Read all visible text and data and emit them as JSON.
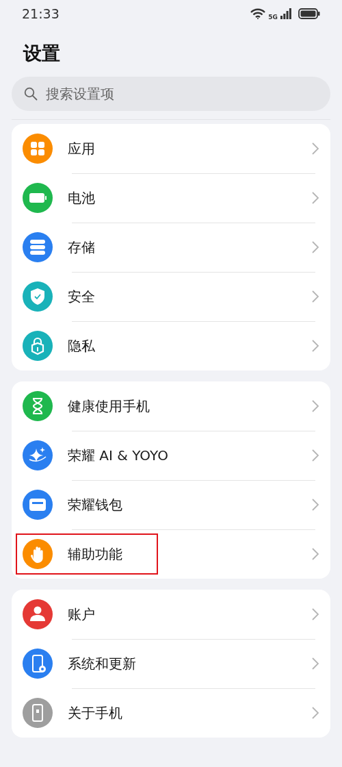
{
  "status_bar": {
    "time": "21:33",
    "network": "5G"
  },
  "title": "设置",
  "search": {
    "placeholder": "搜索设置项"
  },
  "groups": [
    {
      "items": [
        {
          "label": "应用",
          "color": "#fb8c00",
          "highlighted": false
        },
        {
          "label": "电池",
          "color": "#1fb84e",
          "highlighted": false
        },
        {
          "label": "存储",
          "color": "#2a7ff0",
          "highlighted": false
        },
        {
          "label": "安全",
          "color": "#19b2b9",
          "highlighted": false
        },
        {
          "label": "隐私",
          "color": "#19b2b9",
          "highlighted": false
        }
      ]
    },
    {
      "items": [
        {
          "label": "健康使用手机",
          "color": "#1fb84e",
          "highlighted": false
        },
        {
          "label": "荣耀 AI & YOYO",
          "color": "#2a7ff0",
          "highlighted": false
        },
        {
          "label": "荣耀钱包",
          "color": "#2a7ff0",
          "highlighted": false
        },
        {
          "label": "辅助功能",
          "color": "#fb8c00",
          "highlighted": true
        }
      ]
    },
    {
      "items": [
        {
          "label": "账户",
          "color": "#e53935",
          "highlighted": false
        },
        {
          "label": "系统和更新",
          "color": "#2a7ff0",
          "highlighted": false
        },
        {
          "label": "关于手机",
          "color": "#9e9e9e",
          "highlighted": false
        }
      ]
    }
  ]
}
